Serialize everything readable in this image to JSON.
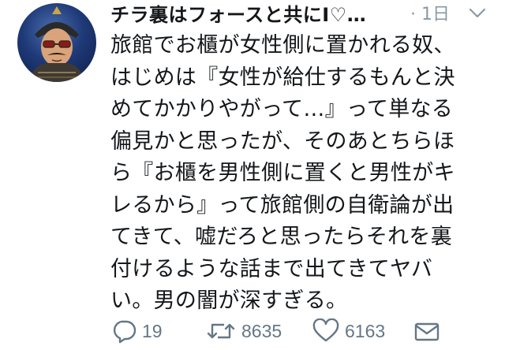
{
  "tweet": {
    "display_name": "チラ裏はフォースと共にI♡…",
    "time": "· 1日",
    "body_lines": [
      "旅館でお櫃が女性側に置かれる奴、",
      "はじめは『女性が給仕するもんと決",
      "めてかかりやがって…』って単なる",
      "偏見かと思ったが、そのあとちらほ",
      "ら『お櫃を男性側に置くと男性がキ",
      "レるから』って旅館側の自衛論が出",
      "てきて、嘘だろと思ったらそれを裏",
      "付けるような話まで出てきてヤバ",
      "い。男の闇が深すぎる。"
    ],
    "actions": {
      "reply_count": "19",
      "retweet_count": "8635",
      "like_count": "6163"
    }
  },
  "icons": {
    "avatar": "samurai-avatar",
    "more": "chevron-down-icon",
    "reply": "reply-icon",
    "retweet": "retweet-icon",
    "like": "heart-icon",
    "dm": "envelope-icon"
  },
  "colors": {
    "text": "#14171a",
    "muted": "#657786"
  }
}
